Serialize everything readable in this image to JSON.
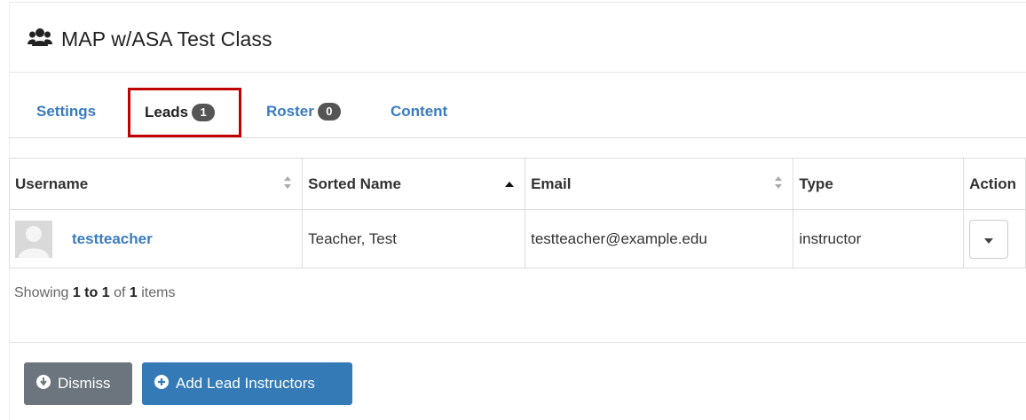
{
  "header": {
    "title": "MAP w/ASA Test Class",
    "icon": "users-icon"
  },
  "tabs": [
    {
      "label": "Settings"
    },
    {
      "label": "Leads",
      "badge": "1"
    },
    {
      "label": "Roster",
      "badge": "0"
    },
    {
      "label": "Content"
    }
  ],
  "table": {
    "columns": [
      "Username",
      "Sorted Name",
      "Email",
      "Type",
      "Action"
    ],
    "rows": [
      {
        "username": "testteacher",
        "sorted_name": "Teacher, Test",
        "email": "testteacher@example.edu",
        "type": "instructor"
      }
    ]
  },
  "pager": {
    "prefix": "Showing",
    "range": "1 to 1",
    "of": "of",
    "total": "1",
    "suffix": "items"
  },
  "buttons": {
    "dismiss": "Dismiss",
    "add_leads": "Add Lead Instructors"
  },
  "colors": {
    "link": "#3a7bbf",
    "primary": "#337ab7",
    "secondary": "#6c757d",
    "highlight": "#c00000",
    "badge": "#555555"
  }
}
